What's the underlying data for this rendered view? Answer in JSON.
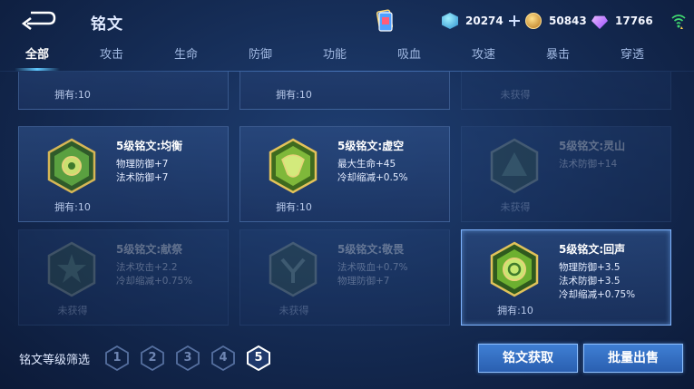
{
  "header": {
    "title": "铭文",
    "back_icon": "back-arrow-icon",
    "currencies": [
      {
        "name": "gem",
        "icon": "diamond-coupon-icon",
        "value": "20274",
        "color": "#3fb4e6"
      },
      {
        "name": "gold",
        "icon": "gold-coin-icon",
        "value": "50843",
        "color": "#d99a2b"
      },
      {
        "name": "crystal",
        "icon": "purple-crystal-icon",
        "value": "17766",
        "color": "#c07aff"
      }
    ]
  },
  "tabs": [
    {
      "label": "全部",
      "active": true
    },
    {
      "label": "攻击"
    },
    {
      "label": "生命"
    },
    {
      "label": "防御"
    },
    {
      "label": "功能"
    },
    {
      "label": "吸血"
    },
    {
      "label": "攻速"
    },
    {
      "label": "暴击"
    },
    {
      "label": "穿透"
    }
  ],
  "inscriptions": {
    "row0": [
      {
        "owned": "拥有:10"
      },
      {
        "owned": "拥有:10"
      },
      {
        "owned": "未获得"
      }
    ],
    "row1": [
      {
        "name": "5级铭文:均衡",
        "stats": [
          "物理防御+7",
          "法术防御+7"
        ],
        "owned": "拥有:10"
      },
      {
        "name": "5级铭文:虚空",
        "stats": [
          "最大生命+45",
          "冷却缩减+0.5%"
        ],
        "owned": "拥有:10"
      },
      {
        "name": "5级铭文:灵山",
        "stats": [
          "法术防御+14"
        ],
        "owned": "未获得"
      }
    ],
    "row2": [
      {
        "name": "5级铭文:献祭",
        "stats": [
          "法术攻击+2.2",
          "冷却缩减+0.75%"
        ],
        "owned": "未获得"
      },
      {
        "name": "5级铭文:敬畏",
        "stats": [
          "法术吸血+0.7%",
          "物理防御+7"
        ],
        "owned": "未获得"
      },
      {
        "name": "5级铭文:回声",
        "stats": [
          "物理防御+3.5",
          "法术防御+3.5",
          "冷却缩减+0.75%"
        ],
        "owned": "拥有:10"
      }
    ]
  },
  "filter": {
    "label": "铭文等级筛选",
    "levels": [
      "1",
      "2",
      "3",
      "4",
      "5"
    ],
    "selected": "5"
  },
  "buttons": {
    "obtain": "铭文获取",
    "sell": "批量出售"
  }
}
